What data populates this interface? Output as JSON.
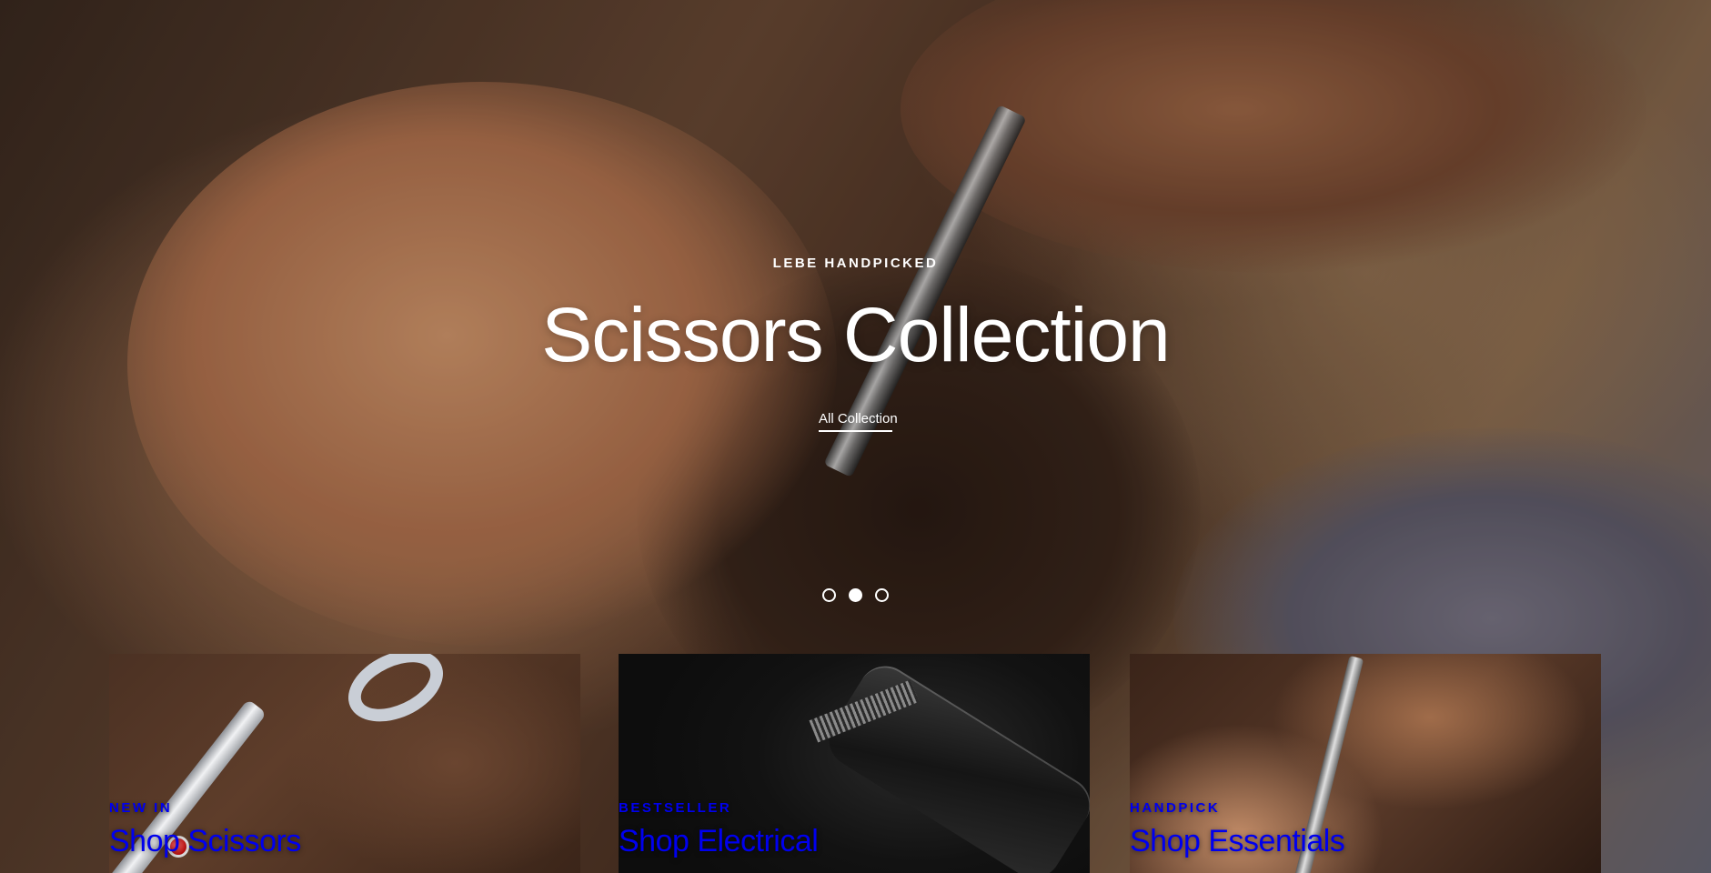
{
  "hero": {
    "eyebrow": "LEBE HANDPICKED",
    "title": "Scissors Collection",
    "link_label": "All Collection",
    "slides_total": 3,
    "active_slide": 2
  },
  "cards": [
    {
      "eyebrow": "NEW IN",
      "title": "Shop Scissors"
    },
    {
      "eyebrow": "BESTSELLER",
      "title": "Shop Electrical"
    },
    {
      "eyebrow": "HANDPICK",
      "title": "Shop Essentials"
    }
  ],
  "colors": {
    "text": "#ffffff",
    "hero_tint": "#6b4a35",
    "card_dark": "#121212"
  }
}
